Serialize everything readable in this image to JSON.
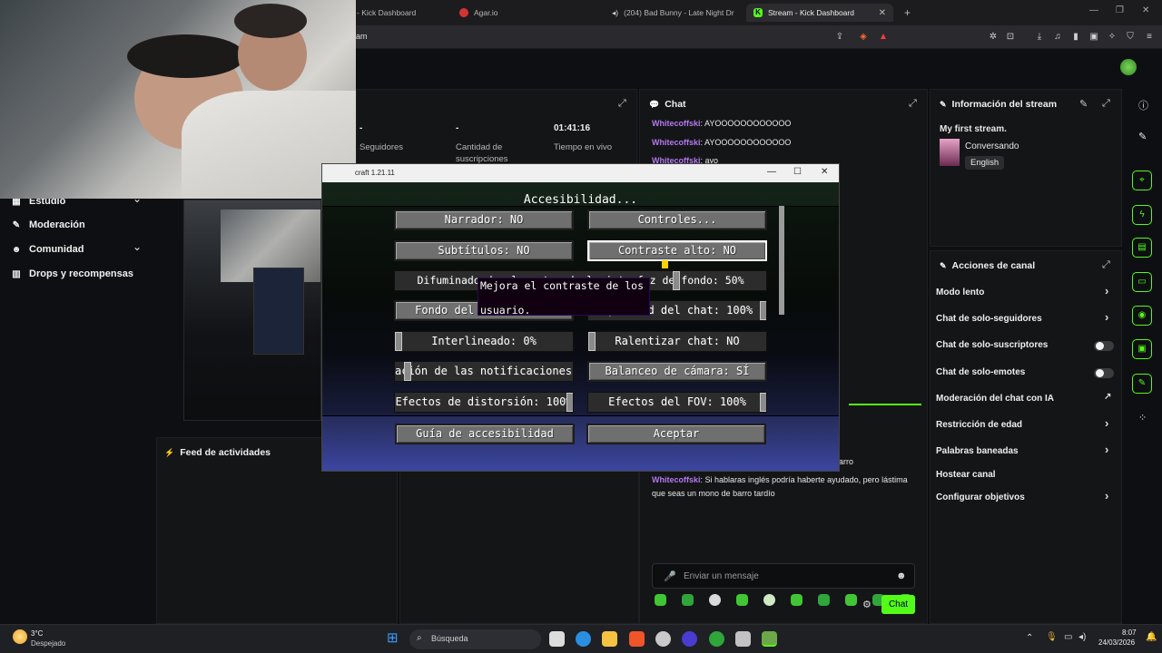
{
  "browser": {
    "tabs": [
      {
        "label": "- Kick Dashboard"
      },
      {
        "label": "Agar.io"
      },
      {
        "label": "(204) Bad Bunny - Late Night Dr"
      },
      {
        "label": "Stream - Kick Dashboard"
      }
    ],
    "url": "am",
    "colors": {
      "accent": "#53fc18"
    }
  },
  "dashboard": {
    "stats": [
      {
        "value": "-",
        "label": "Seguidores"
      },
      {
        "value": "-",
        "label": "Cantidad de suscripciones"
      },
      {
        "value": "01:41:16",
        "label": "Tiempo en vivo"
      }
    ],
    "nav": [
      {
        "label": "Estudio",
        "icon": "studio-icon"
      },
      {
        "label": "Moderación",
        "icon": "wrench-icon"
      },
      {
        "label": "Comunidad",
        "icon": "community-icon"
      },
      {
        "label": "Drops y recompensas",
        "icon": "drops-icon"
      }
    ],
    "activity_feed_title": "Feed de actividades",
    "chat": {
      "title": "Chat",
      "messages": [
        {
          "user": "Whitecoffski",
          "text": "AYOOOOOOOOOOOO"
        },
        {
          "user": "Whitecoffski",
          "text": "AYOOOOOOOOOOOO"
        },
        {
          "user": "Whitecoffski",
          "text": "ayo"
        }
      ],
      "partial_text": "arro",
      "last_message": {
        "user": "Whitecoffski",
        "text_line1": "Si hablaras inglés podría haberte ayudado, pero lástima",
        "text_line2": "que seas un mono de barro tardío"
      },
      "input_placeholder": "Enviar un mensaje",
      "send_label": "Chat"
    },
    "stream_info": {
      "title": "Información del stream",
      "stream_title": "My first stream.",
      "category": "Conversando",
      "language": "English"
    },
    "channel_actions": {
      "title": "Acciones de canal",
      "items": [
        {
          "label": "Modo lento",
          "control": "chevron"
        },
        {
          "label": "Chat de solo-seguidores",
          "control": "chevron"
        },
        {
          "label": "Chat de solo-suscriptores",
          "control": "toggle"
        },
        {
          "label": "Chat de solo-emotes",
          "control": "toggle"
        },
        {
          "label": "Moderación del chat con IA",
          "control": "external"
        },
        {
          "label": "Restricción de edad",
          "control": "chevron"
        },
        {
          "label": "Palabras baneadas",
          "control": "chevron"
        },
        {
          "label": "Hostear canal",
          "control": "none"
        },
        {
          "label": "Configurar objetivos",
          "control": "chevron"
        }
      ]
    }
  },
  "minecraft": {
    "window_title": "craft 1.21.11",
    "screen_title": "Accesibilidad...",
    "buttons": {
      "narrator": "Narrador: NO",
      "controls": "Controles...",
      "subtitles": "Subtítulos: NO",
      "high_contrast": "Contraste alto: NO",
      "blur": "Difuminado de elementos de la interfaz de fondo: 50%",
      "text_bg": "Fondo del texto: Chat",
      "chat_opacity": "Opacidad del chat: 100%",
      "line_spacing": "Interlineado: 0%",
      "chat_delay": "Ralentizar chat: NO",
      "notification": "ación de las notificaciones: x",
      "camera_bob": "Balanceo de cámara: SÍ",
      "distortion": "Efectos de distorsión: 100%",
      "fov": "Efectos del FOV: 100%",
      "guide": "Guía de accesibilidad",
      "done": "Aceptar"
    },
    "tooltip_line1": "Mejora el contraste de los",
    "tooltip_line2": "usuario."
  },
  "taskbar": {
    "weather_temp": "3°C",
    "weather_desc": "Despejado",
    "search_placeholder": "Búsqueda",
    "time": "8:07",
    "date": "24/03/2026"
  }
}
